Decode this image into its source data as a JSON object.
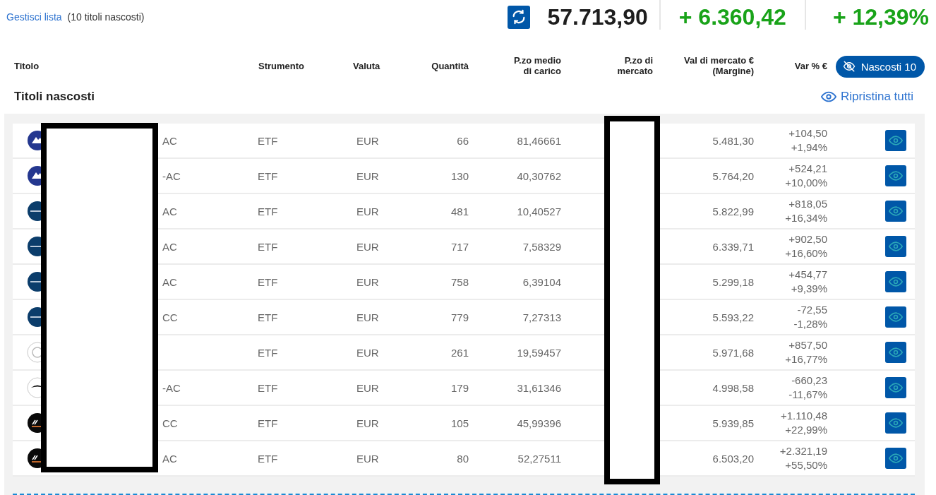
{
  "summary": {
    "manage_link": "Gestisci lista",
    "hidden_note": "(10 titoli nascosti)",
    "total": "57.713,90",
    "gain": "+ 6.360,42",
    "gain_pct": "+ 12,39%"
  },
  "columns": [
    "Titolo",
    "Strumento",
    "Valuta",
    "Quantità",
    "P.zo medio di carico",
    "P.zo di mercato",
    "Val di mercato € (Margine)",
    "Var % €"
  ],
  "hidden_toggle": {
    "label": "Nascosti 10"
  },
  "section": {
    "title": "Titoli nascosti",
    "restore": "Ripristina tutti"
  },
  "rows": [
    {
      "kind": "invesco",
      "title": "AC",
      "instrument": "ETF",
      "currency": "EUR",
      "quantity": "66",
      "avg_price": "81,46661",
      "market_value": "5.481,30",
      "var_abs": "+104,50",
      "var_pct": "+1,94%"
    },
    {
      "kind": "invesco",
      "title": "-AC",
      "instrument": "ETF",
      "currency": "EUR",
      "quantity": "130",
      "avg_price": "40,30762",
      "market_value": "5.764,20",
      "var_abs": "+524,21",
      "var_pct": "+10,00%"
    },
    {
      "kind": "blackrock",
      "title": "AC",
      "instrument": "ETF",
      "currency": "EUR",
      "quantity": "481",
      "avg_price": "10,40527",
      "market_value": "5.822,99",
      "var_abs": "+818,05",
      "var_pct": "+16,34%"
    },
    {
      "kind": "blackrock",
      "title": "AC",
      "instrument": "ETF",
      "currency": "EUR",
      "quantity": "717",
      "avg_price": "7,58329",
      "market_value": "6.339,71",
      "var_abs": "+902,50",
      "var_pct": "+16,60%"
    },
    {
      "kind": "blackrock",
      "title": "AC",
      "instrument": "ETF",
      "currency": "EUR",
      "quantity": "758",
      "avg_price": "6,39104",
      "market_value": "5.299,18",
      "var_abs": "+454,77",
      "var_pct": "+9,39%"
    },
    {
      "kind": "blackrock",
      "title": "CC",
      "instrument": "ETF",
      "currency": "EUR",
      "quantity": "779",
      "avg_price": "7,27313",
      "market_value": "5.593,22",
      "var_abs": "-72,55",
      "var_pct": "-1,28%"
    },
    {
      "kind": "outline",
      "instrument": "ETF",
      "currency": "EUR",
      "quantity": "261",
      "avg_price": "19,59457",
      "market_value": "5.971,68",
      "var_abs": "+857,50",
      "var_pct": "+16,77%"
    },
    {
      "kind": "bird",
      "title": "-AC",
      "instrument": "ETF",
      "currency": "EUR",
      "quantity": "179",
      "avg_price": "31,61346",
      "market_value": "4.998,58",
      "var_abs": "-660,23",
      "var_pct": "-11,67%"
    },
    {
      "kind": "xtrackers",
      "title": "CC",
      "instrument": "ETF",
      "currency": "EUR",
      "quantity": "105",
      "avg_price": "45,99396",
      "market_value": "5.939,85",
      "var_abs": "+1.110,48",
      "var_pct": "+22,99%"
    },
    {
      "kind": "xtrackers",
      "title": "AC",
      "instrument": "ETF",
      "currency": "EUR",
      "quantity": "80",
      "avg_price": "52,27511",
      "market_value": "6.503,20",
      "var_abs": "+2.321,19",
      "var_pct": "+55,50%"
    }
  ]
}
